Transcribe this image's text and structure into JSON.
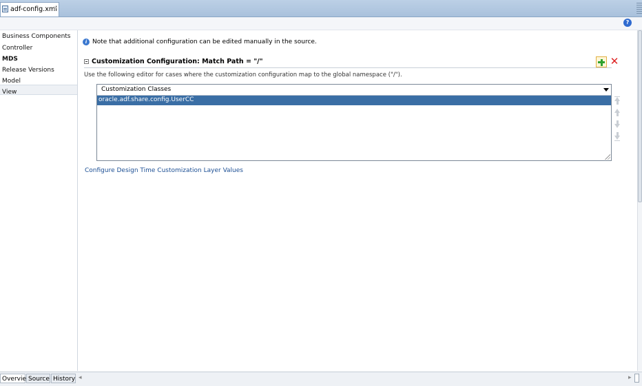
{
  "editor_tab": {
    "label": "adf-config.xml",
    "close": "×",
    "icon": "xml-file-icon"
  },
  "help": {
    "label": "?"
  },
  "sidebar": {
    "items": [
      {
        "label": "Business Components"
      },
      {
        "label": "Controller"
      },
      {
        "label": "MDS",
        "selected": true
      },
      {
        "label": "Release Versions"
      },
      {
        "label": "Model"
      },
      {
        "label": "View"
      }
    ]
  },
  "main": {
    "note": "Note that additional configuration can be edited manually in the source.",
    "section_title": "Customization Configuration: Match Path = \"/\"",
    "description": "Use the following editor for cases where the customization configuration map to the global namespace (\"/\").",
    "list": {
      "header": "Customization Classes",
      "rows": [
        "oracle.adf.share.config.UserCC"
      ]
    },
    "link": "Configure Design Time Customization Layer Values"
  },
  "bottom_tabs": [
    {
      "label": "Overview",
      "selected": true
    },
    {
      "label": "Source"
    },
    {
      "label": "History"
    }
  ],
  "colors": {
    "selection": "#3a6ea5",
    "link": "#1c4f94",
    "add": "#2ea12e",
    "delete": "#d22222"
  }
}
